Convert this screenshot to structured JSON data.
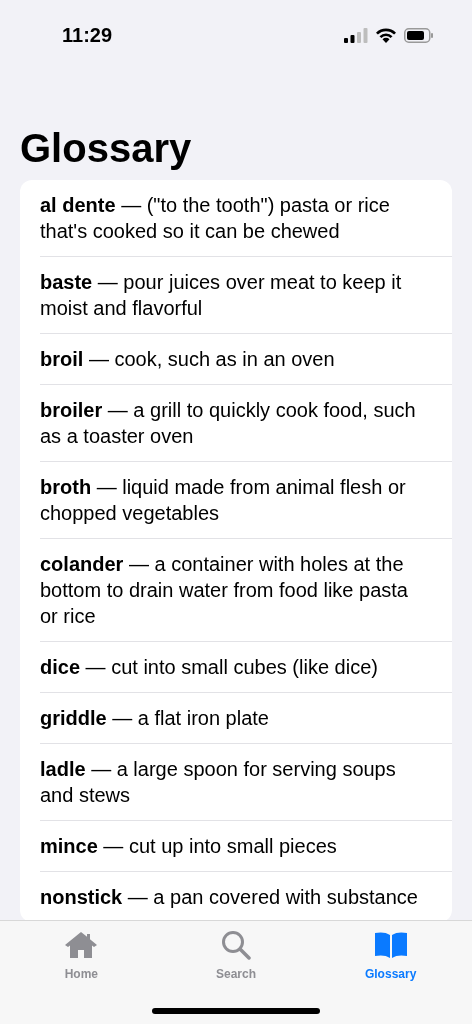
{
  "status_bar": {
    "time": "11:29"
  },
  "title": "Glossary",
  "entries": [
    {
      "text": "**al dente** — (\"to the tooth\") pasta or rice that's cooked so it can be chewed"
    },
    {
      "text": "**baste** — pour juices over meat to keep it moist and flavorful"
    },
    {
      "text": "**broil** — cook, such as in an oven"
    },
    {
      "text": "**broiler** — a grill to quickly cook food, such as a toaster oven"
    },
    {
      "text": "**broth** — liquid made from animal flesh or chopped vegetables"
    },
    {
      "text": "**colander** — a container with holes at the bottom to drain water from food like pasta or rice"
    },
    {
      "text": "**dice** — cut into small cubes (like dice)"
    },
    {
      "text": "**griddle** — a flat iron plate"
    },
    {
      "text": "**ladle** — a large spoon for serving soups and stews"
    },
    {
      "text": "**mince** — cut up into small pieces"
    },
    {
      "text": "**nonstick** — a pan covered with substance"
    }
  ],
  "tabs": [
    {
      "kind": "home",
      "label": "Home",
      "selected": false
    },
    {
      "kind": "search",
      "label": "Search",
      "selected": false
    },
    {
      "kind": "book",
      "label": "Glossary",
      "selected": true
    }
  ]
}
